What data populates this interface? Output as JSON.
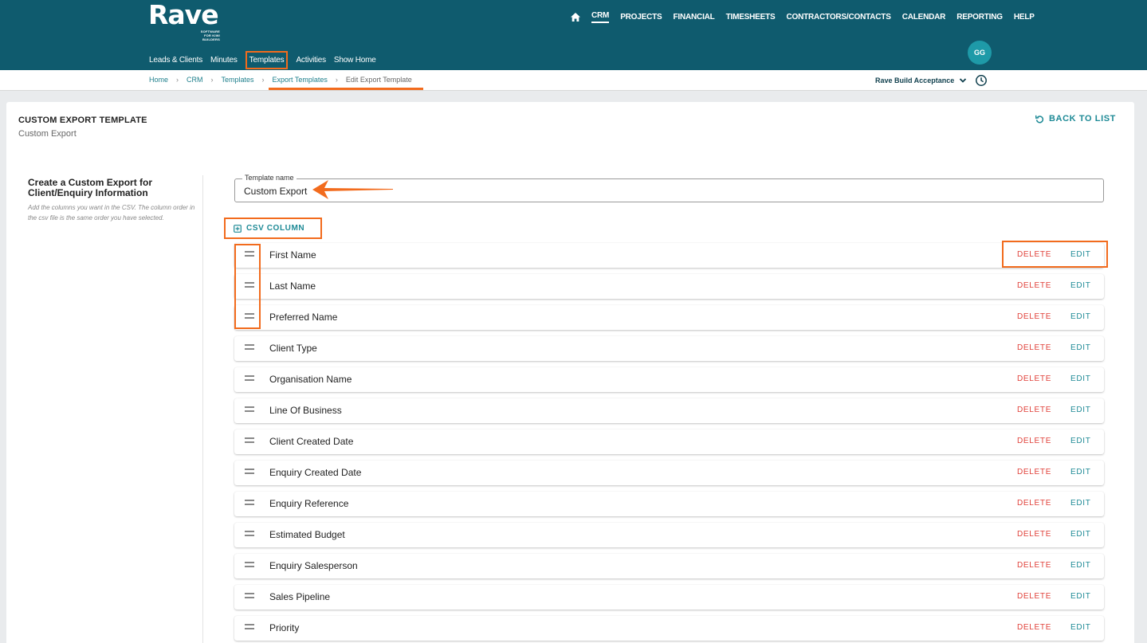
{
  "header": {
    "logo": "Rave",
    "logo_tagline": "SOFTWARE FOR KIWI BUILDERS",
    "main_nav": [
      "CRM",
      "PROJECTS",
      "FINANCIAL",
      "TIMESHEETS",
      "CONTRACTORS/CONTACTS",
      "CALENDAR",
      "REPORTING",
      "HELP"
    ],
    "sub_nav": [
      "Leads & Clients",
      "Minutes",
      "Templates",
      "Activities",
      "Show Home"
    ],
    "avatar": "GG"
  },
  "breadcrumb": [
    "Home",
    "CRM",
    "Templates",
    "Export Templates",
    "Edit Export Template"
  ],
  "company_select": "Rave Build Acceptance",
  "card": {
    "title": "CUSTOM EXPORT TEMPLATE",
    "subtitle": "Custom Export",
    "back_label": "BACK TO LIST"
  },
  "side": {
    "heading": "Create a Custom Export for Client/Enquiry Information",
    "help": "Add the columns you want in the CSV. The column order in the csv file is the same order you have selected."
  },
  "template_field": {
    "label": "Template name",
    "value": "Custom Export"
  },
  "csv_button": "CSV COLUMN",
  "columns": [
    "First Name",
    "Last Name",
    "Preferred Name",
    "Client Type",
    "Organisation Name",
    "Line Of Business",
    "Client Created Date",
    "Enquiry Created Date",
    "Enquiry Reference",
    "Estimated Budget",
    "Enquiry Salesperson",
    "Sales Pipeline",
    "Priority"
  ],
  "row_actions": {
    "delete": "DELETE",
    "edit": "EDIT"
  },
  "colors": {
    "header": "#0f5b6e",
    "accent": "#1e8a96",
    "danger": "#e0413a",
    "highlight": "#f26b1d"
  }
}
